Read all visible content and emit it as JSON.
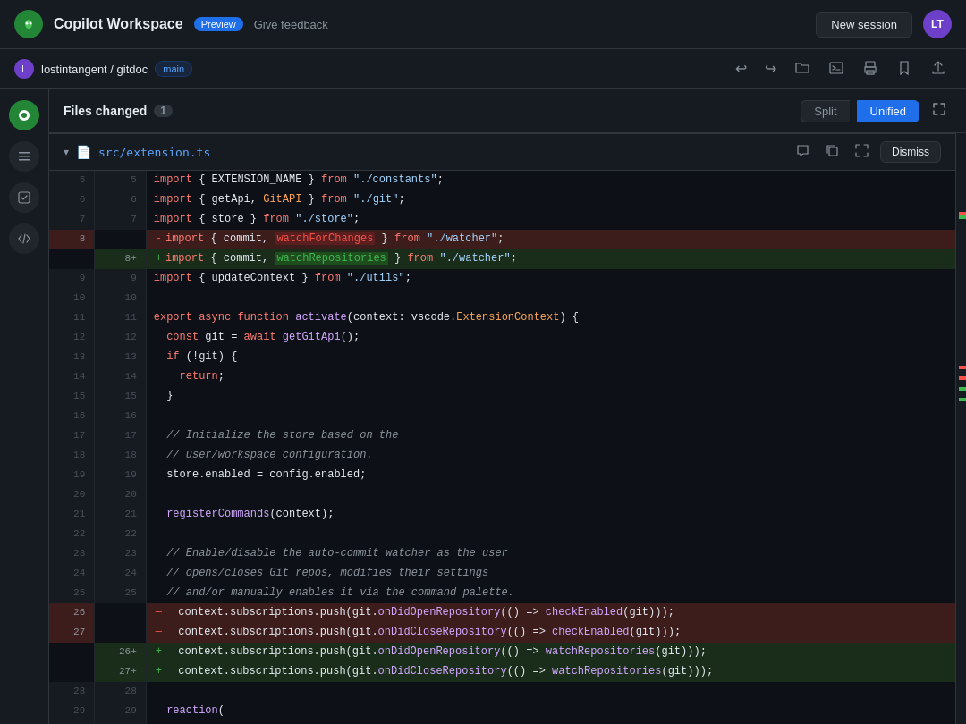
{
  "topbar": {
    "title": "Copilot Workspace",
    "preview_label": "Preview",
    "feedback_label": "Give feedback",
    "new_session_label": "New session",
    "avatar_initials": "LT"
  },
  "secondbar": {
    "user": "lostintangent",
    "repo": "gitdoc",
    "branch": "main",
    "separator": "/"
  },
  "toolbar": {
    "split_label": "Split",
    "unified_label": "Unified"
  },
  "files_changed": {
    "title": "Files changed",
    "count": "1"
  },
  "file": {
    "path": "src/extension.ts",
    "dismiss_label": "Dismiss"
  },
  "icons": {
    "undo": "↩",
    "redo": "↪",
    "folder": "📁",
    "terminal": "⬛",
    "print": "🖨",
    "bookmark": "🔖",
    "share": "⬆"
  }
}
